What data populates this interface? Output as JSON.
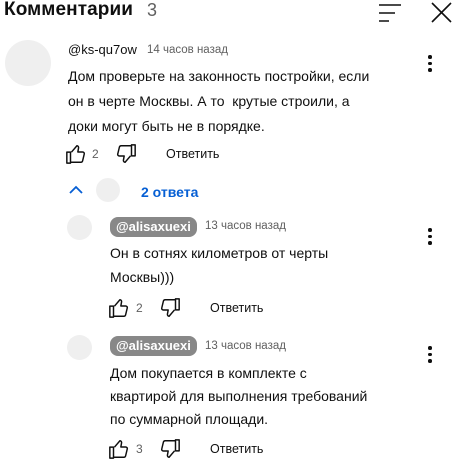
{
  "header": {
    "title": "Комментарии",
    "count": "3"
  },
  "comments": [
    {
      "author": "@ks-qu7ow",
      "time": "14 часов назад",
      "lines": [
        "Дом проверьте на законность постройки, если",
        "он в черте Москвы. А то  крутые строили, а",
        "доки могут быть не в порядке."
      ],
      "likes": "2",
      "reply_label": "Ответить"
    }
  ],
  "replies_toggle": {
    "label": "2 ответа"
  },
  "replies": [
    {
      "author": "@alisaxuexi",
      "time": "13 часов назад",
      "lines": [
        "Он в сотнях километров от черты",
        "Москвы)))"
      ],
      "likes": "2",
      "reply_label": "Ответить"
    },
    {
      "author": "@alisaxuexi",
      "time": "13 часов назад",
      "lines": [
        "Дом покупается в комплекте с",
        "квартирой для выполнения требований",
        "по суммарной площади."
      ],
      "likes": "3",
      "reply_label": "Ответить"
    }
  ],
  "icons": {
    "sort": "sort-icon",
    "close": "close-icon",
    "more": "more-vertical-icon",
    "like": "thumb-up-icon",
    "dislike": "thumb-down-icon",
    "chevron": "chevron-up-icon"
  },
  "colors": {
    "link": "#065fd4",
    "pill_bg": "#888888",
    "secondary_text": "#606060"
  }
}
